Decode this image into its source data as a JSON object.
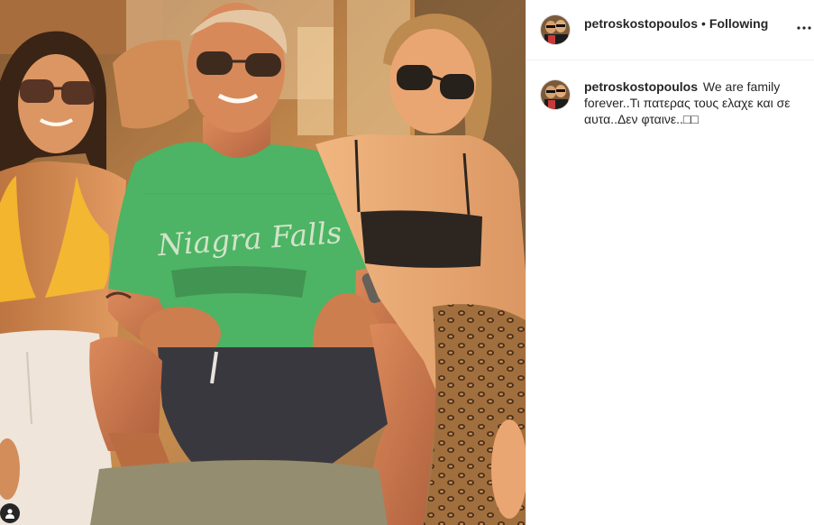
{
  "post": {
    "username": "petroskostopoulos",
    "follow_separator": "•",
    "follow_status": "Following",
    "more_options_icon": "more-horizontal-icon",
    "caption": {
      "username": "petroskostopoulos",
      "text": "We are family forever..Τι πατερας τους ελαχε και σε αυτα..Δεν φταινε..□□"
    },
    "photo": {
      "shirt_text_line1": "Niagra Falls",
      "user_tag_icon": "user-tag-icon"
    }
  },
  "colors": {
    "text": "#262626",
    "divider": "#efefef",
    "shirt": "#3db564",
    "sun": "#e8a25a"
  }
}
